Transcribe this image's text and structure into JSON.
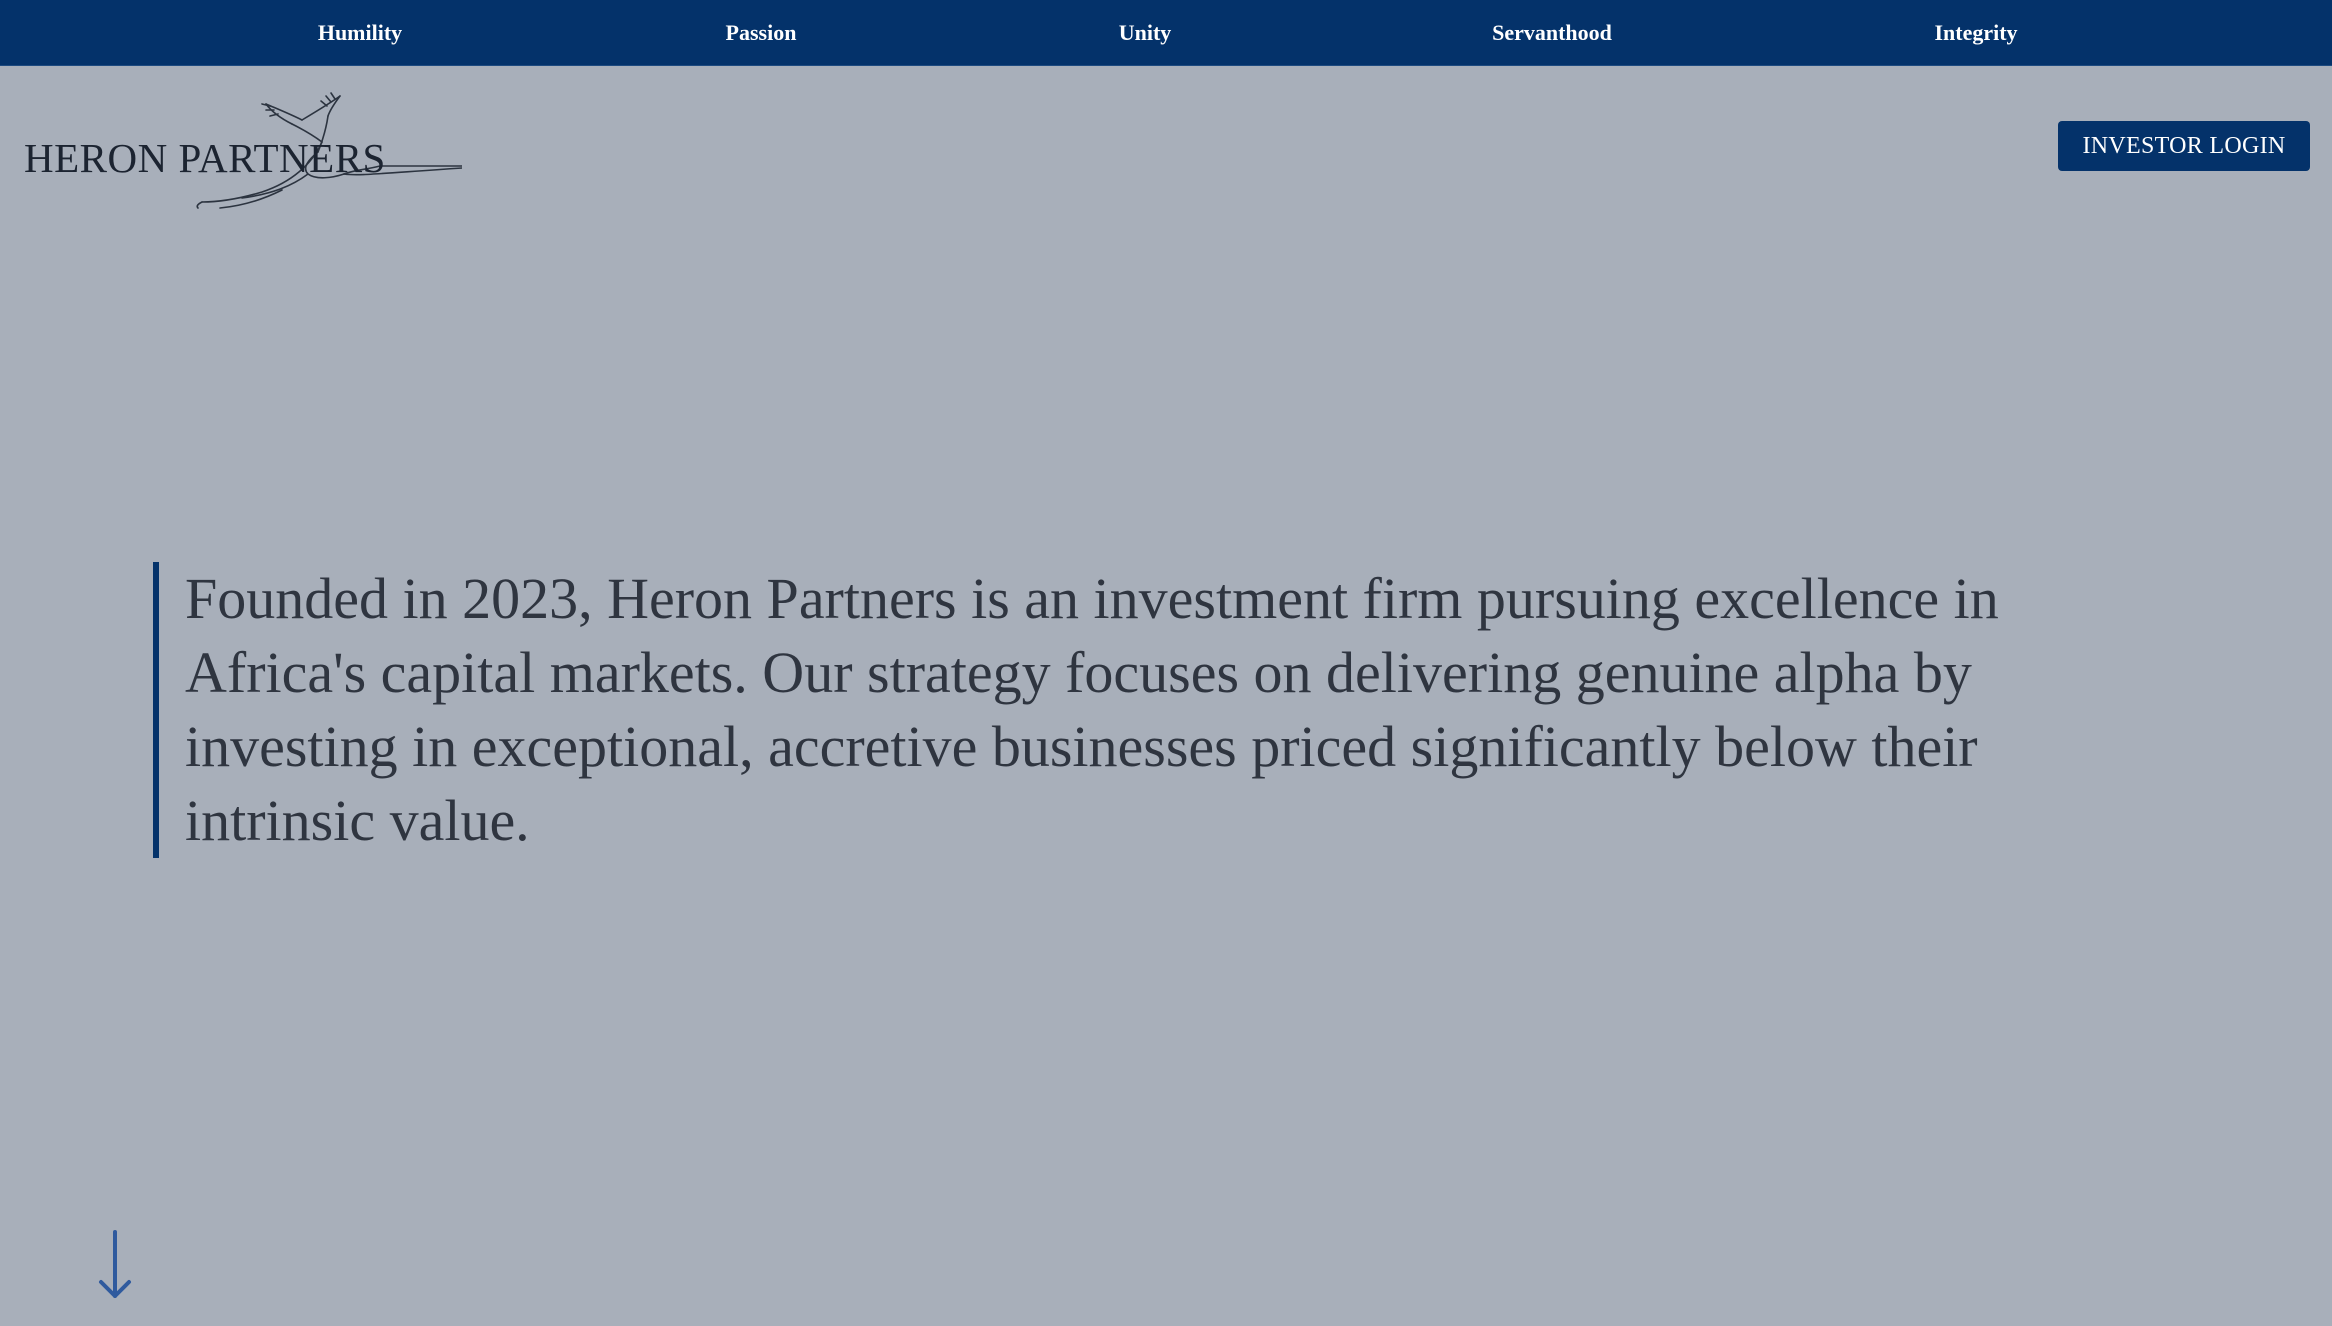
{
  "nav": {
    "items": [
      {
        "label": "Humility"
      },
      {
        "label": "Passion"
      },
      {
        "label": "Unity"
      },
      {
        "label": "Servanthood"
      },
      {
        "label": "Integrity"
      }
    ]
  },
  "brand": {
    "name": "HERON PARTNERS",
    "icon": "heron-bird-icon"
  },
  "header": {
    "login_label": "INVESTOR LOGIN"
  },
  "hero": {
    "statement": "Founded in 2023, Heron Partners is an investment firm pursuing excellence in Africa's capital markets. Our strategy focuses on delivering genuine alpha by investing in exceptional, accretive businesses priced significantly below their intrinsic value."
  },
  "scroll": {
    "icon": "arrow-down-icon"
  },
  "colors": {
    "background": "#a8afba",
    "navy": "#04326a",
    "text": "#2f3540",
    "arrow": "#2f5a9e"
  }
}
